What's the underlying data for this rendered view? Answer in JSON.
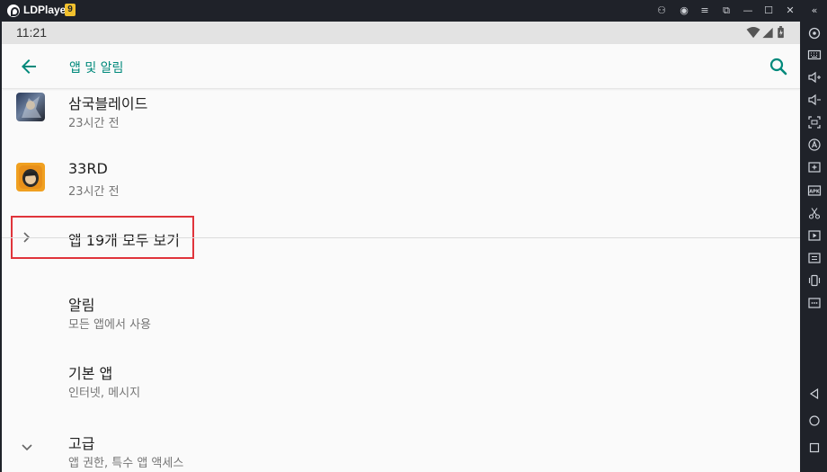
{
  "window": {
    "app_name": "LDPlayer",
    "version_badge": "9"
  },
  "titlebar_buttons": [
    {
      "name": "gamepad-icon",
      "glyph": "⚇"
    },
    {
      "name": "account-icon",
      "glyph": "◉"
    },
    {
      "name": "menu-icon",
      "glyph": "≡"
    },
    {
      "name": "restore-icon",
      "glyph": "⧉"
    },
    {
      "name": "minimize-icon",
      "glyph": "—"
    },
    {
      "name": "maximize-icon",
      "glyph": "☐"
    },
    {
      "name": "close-icon",
      "glyph": "✕"
    },
    {
      "name": "collapse-sidebar-icon",
      "glyph": "«"
    }
  ],
  "status_bar": {
    "time": "11:21"
  },
  "app_bar": {
    "title": "앱 및 알림"
  },
  "recent_apps": [
    {
      "name": "삼국블레이드",
      "subtitle": "23시간 전",
      "icon": "samguk-blade-app-icon"
    },
    {
      "name": "33RD",
      "subtitle": "23시간 전",
      "icon": "33rd-app-icon"
    }
  ],
  "see_all": {
    "label": "앱 19개 모두 보기"
  },
  "settings": [
    {
      "title": "알림",
      "subtitle": "모든 앱에서 사용"
    },
    {
      "title": "기본 앱",
      "subtitle": "인터넷, 메시지"
    },
    {
      "title": "고급",
      "subtitle": "앱 권한, 특수 앱 액세스"
    }
  ],
  "colors": {
    "accent": "#00897b",
    "highlight_box": "#e0343b",
    "frame": "#1f2229"
  }
}
